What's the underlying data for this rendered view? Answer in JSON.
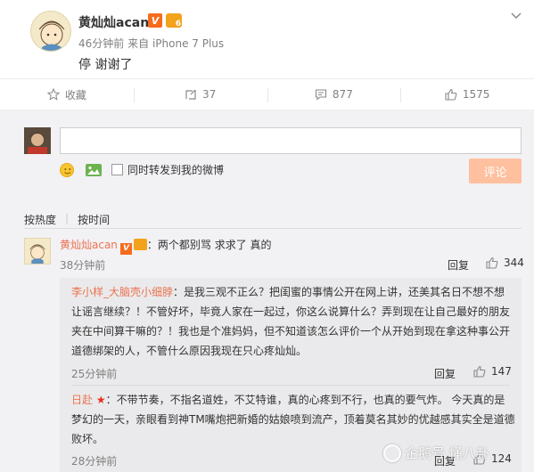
{
  "post": {
    "author": "黄灿灿acan",
    "time": "46分钟前",
    "source_prefix": "来自",
    "source": "iPhone 7 Plus",
    "text": "停 谢谢了",
    "badge_v": "V"
  },
  "actions": {
    "favorite": "收藏",
    "repost": "37",
    "comment": "877",
    "like": "1575"
  },
  "composer": {
    "forward_label": "同时转发到我的微博",
    "submit_label": "评论",
    "input_value": ""
  },
  "sort": {
    "hot": "按热度",
    "time": "按时间"
  },
  "comment": {
    "author": "黄灿灿acan",
    "badge_v": "V",
    "text": "：两个都别骂 求求了 真的",
    "time": "38分钟前",
    "reply_label": "回复",
    "likes": "344"
  },
  "replies": [
    {
      "author": "李小样_大脑壳小细脖",
      "text": "：是我三观不正么？把闺蜜的事情公开在网上讲，还美其名日不想不想让谣言继续？！不管好坏，毕竟人家在一起过，你这么说算什么？弄到现在让自己最好的朋友夹在中间算干嘛的？！我也是个准妈妈，但不知道该怎么评价一个从开始到现在拿这种事公开道德绑架的人，不管什么原因我现在只心疼灿灿。",
      "time": "25分钟前",
      "reply_label": "回复",
      "likes": "147"
    },
    {
      "author": "日赴",
      "star": "★",
      "text": "：不带节奏，不指名道姓，不艾特谁，真的心疼到不行，也真的要气炸。 今天真的是梦幻的一天，亲眼看到神TM嘴炮把新婚的姑娘喷到流产，顶着莫名其妙的优越感其实全是道德败坏。",
      "time": "28分钟前",
      "reply_label": "回复",
      "likes": "124"
    }
  ],
  "watermark": "企鹅号 懂八卦",
  "colors": {
    "accent": "#eb7350",
    "submit_disabled": "#ffc09f",
    "panel": "#f2f2f5"
  }
}
